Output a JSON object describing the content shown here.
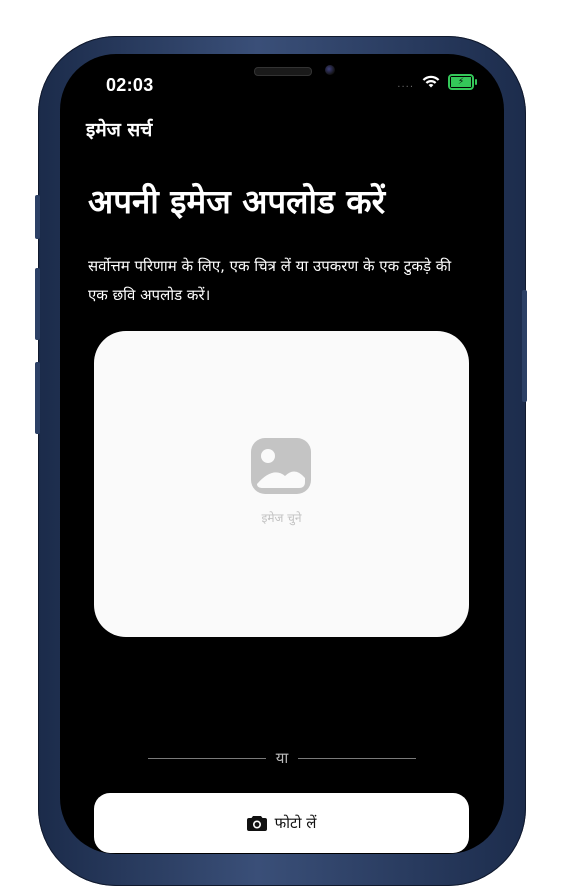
{
  "status_bar": {
    "time": "02:03",
    "signal_dots": "....",
    "wifi_icon": "wifi-icon",
    "battery_icon": "battery-charging-icon"
  },
  "nav": {
    "title": "इमेज सर्च"
  },
  "main": {
    "title": "अपनी इमेज अपलोड करें",
    "subtitle": "सर्वोत्तम परिणाम के लिए, एक चित्र लें या उपकरण के एक टुकड़े की एक छवि अपलोड करें।",
    "upload": {
      "label": "इमेज चुने",
      "icon": "image-icon"
    },
    "divider_text": "या",
    "take_photo": {
      "label": "फोटो लें",
      "icon": "camera-icon"
    }
  },
  "colors": {
    "background": "#000000",
    "card": "#fafafa",
    "battery": "#34c759",
    "placeholder_icon": "#c4c4c4"
  }
}
